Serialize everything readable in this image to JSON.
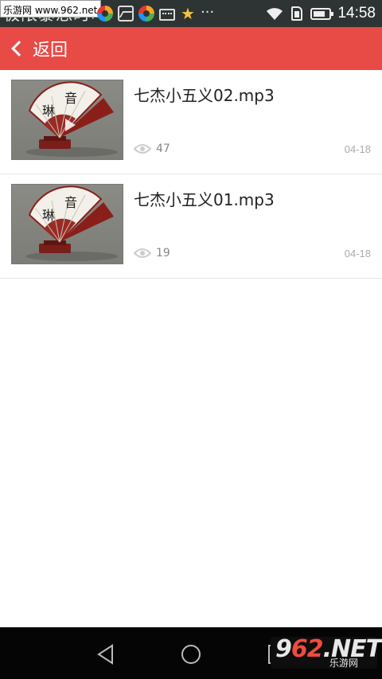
{
  "status_bar": {
    "title": "极限暴怒时叫",
    "watermark": "乐游网 www.962.net",
    "icons": [
      "app-ring-icon",
      "gallery-icon",
      "app-ring-icon",
      "keyboard-icon",
      "star-icon",
      "more-dots-icon"
    ],
    "time": "14:58"
  },
  "header": {
    "back_label": "返回",
    "color": "#e84a45"
  },
  "items": [
    {
      "title": "七杰小五义02.mp3",
      "views": "47",
      "date": "04-18"
    },
    {
      "title": "七杰小五义01.mp3",
      "views": "19",
      "date": "04-18"
    }
  ],
  "navbar": {
    "logo_main_a": "9",
    "logo_main_b": "62",
    "logo_main_c": ".NET",
    "logo_sub": "乐游网"
  }
}
